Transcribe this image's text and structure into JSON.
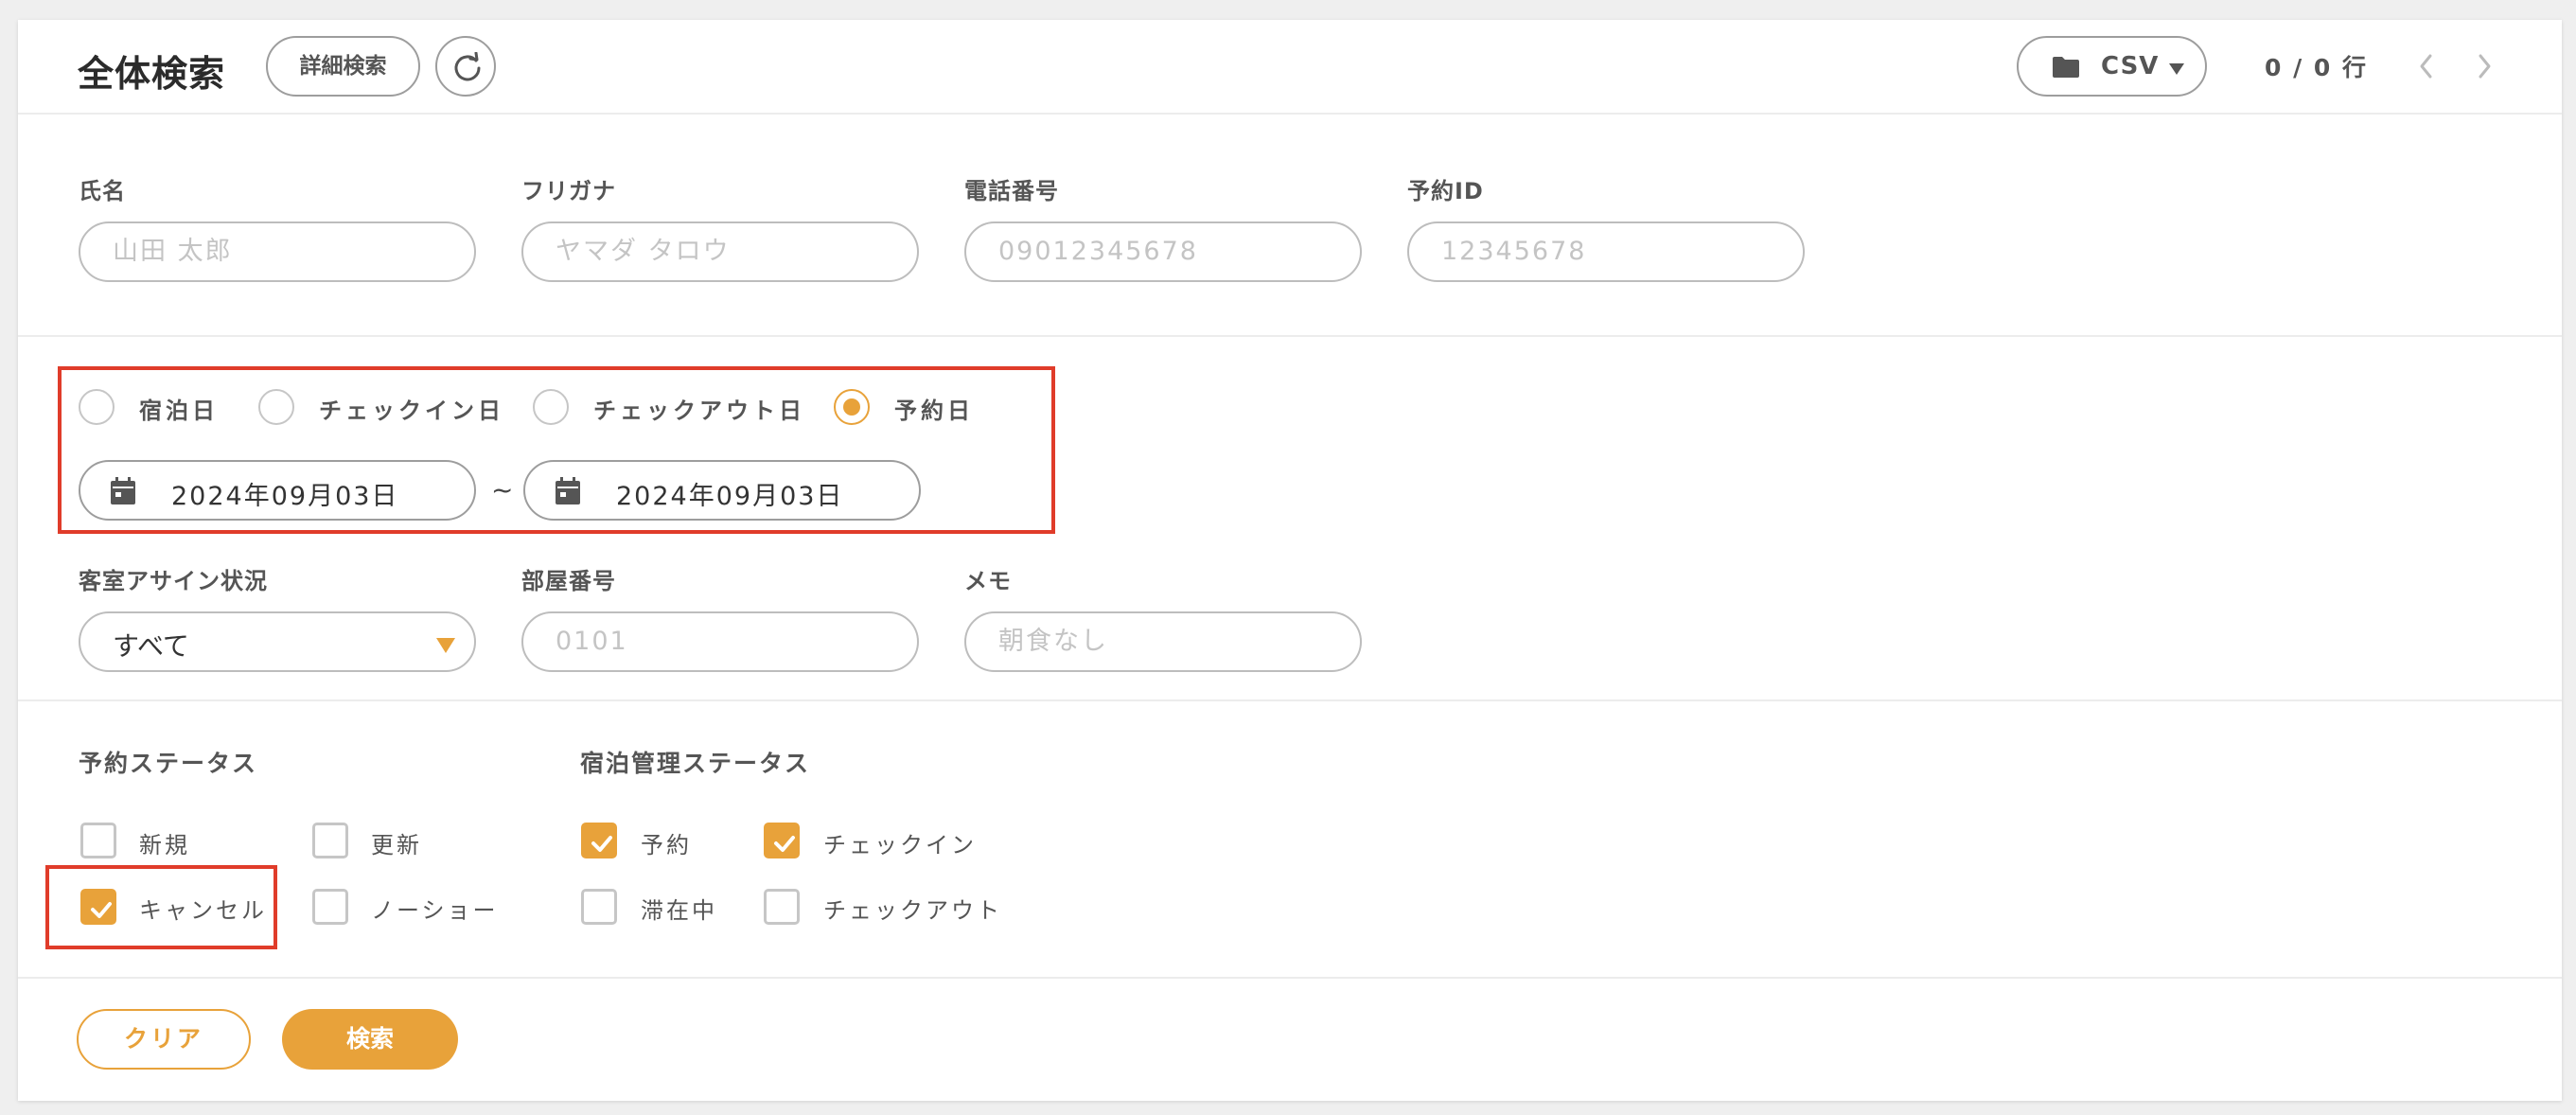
{
  "header": {
    "title": "全体検索",
    "detail_search_label": "詳細検索",
    "csv_label": "CSV",
    "rows_indicator": "0 / 0 行"
  },
  "fields_row1": [
    {
      "label": "氏名",
      "placeholder": "山田 太郎"
    },
    {
      "label": "フリガナ",
      "placeholder": "ヤマダ タロウ"
    },
    {
      "label": "電話番号",
      "placeholder": "09012345678"
    },
    {
      "label": "予約ID",
      "placeholder": "12345678"
    }
  ],
  "date_type": {
    "options": [
      "宿泊日",
      "チェックイン日",
      "チェックアウト日",
      "予約日"
    ],
    "selected": "予約日"
  },
  "date_range": {
    "from": "2024年09月03日",
    "separator": "~",
    "to": "2024年09月03日"
  },
  "fields_row2": {
    "assign_label": "客室アサイン状況",
    "assign_value": "すべて",
    "room_label": "部屋番号",
    "room_placeholder": "0101",
    "memo_label": "メモ",
    "memo_placeholder": "朝食なし"
  },
  "reservation_status": {
    "label": "予約ステータス",
    "items": [
      {
        "label": "新規",
        "checked": false
      },
      {
        "label": "更新",
        "checked": false
      },
      {
        "label": "キャンセル",
        "checked": true
      },
      {
        "label": "ノーショー",
        "checked": false
      }
    ]
  },
  "stay_status": {
    "label": "宿泊管理ステータス",
    "items": [
      {
        "label": "予約",
        "checked": true
      },
      {
        "label": "チェックイン",
        "checked": true
      },
      {
        "label": "滞在中",
        "checked": false
      },
      {
        "label": "チェックアウト",
        "checked": false
      }
    ]
  },
  "actions": {
    "clear_label": "クリア",
    "search_label": "検索"
  },
  "colors": {
    "accent": "#e8a23a",
    "highlight": "#e03c2a"
  }
}
